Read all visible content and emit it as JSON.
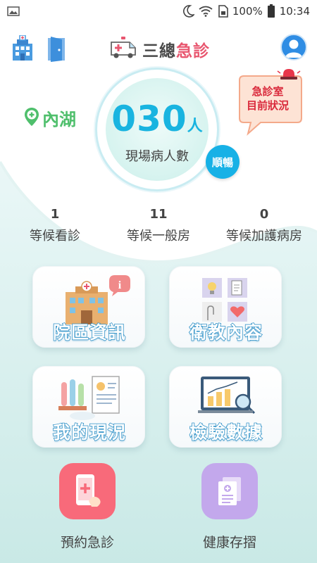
{
  "status_bar": {
    "battery": "100%",
    "time": "10:34",
    "icons": [
      "image-icon",
      "moon-icon",
      "wifi-icon",
      "sim-icon",
      "battery-icon"
    ]
  },
  "header": {
    "brand_part1": "三總",
    "brand_part2": "急診",
    "icons": [
      "hospital-icon",
      "door-icon",
      "ambulance-icon",
      "user-avatar-icon"
    ]
  },
  "location": {
    "name": "內湖",
    "icon": "location-pin-icon",
    "color": "#4fbf6c"
  },
  "patients": {
    "count": "030",
    "unit": "人",
    "label": "現場病人數",
    "status": "順暢",
    "accent": "#19b4e0"
  },
  "er_status": {
    "line1": "急診室",
    "line2": "目前狀況",
    "icon": "siren-icon"
  },
  "waiting": [
    {
      "value": "1",
      "label": "等候看診"
    },
    {
      "value": "11",
      "label": "等候一般房"
    },
    {
      "value": "0",
      "label": "等候加護病房"
    }
  ],
  "cards": [
    {
      "label": "院區資訊",
      "icon": "hospital-info-icon"
    },
    {
      "label": "衛教內容",
      "icon": "health-education-icon"
    },
    {
      "label": "我的現況",
      "icon": "my-status-icon"
    },
    {
      "label": "檢驗數據",
      "icon": "lab-data-icon"
    }
  ],
  "actions": [
    {
      "label": "預約急診",
      "icon": "phone-medical-icon",
      "color": "#f86a7a"
    },
    {
      "label": "健康存摺",
      "icon": "health-passbook-icon",
      "color": "#b89be6"
    }
  ]
}
